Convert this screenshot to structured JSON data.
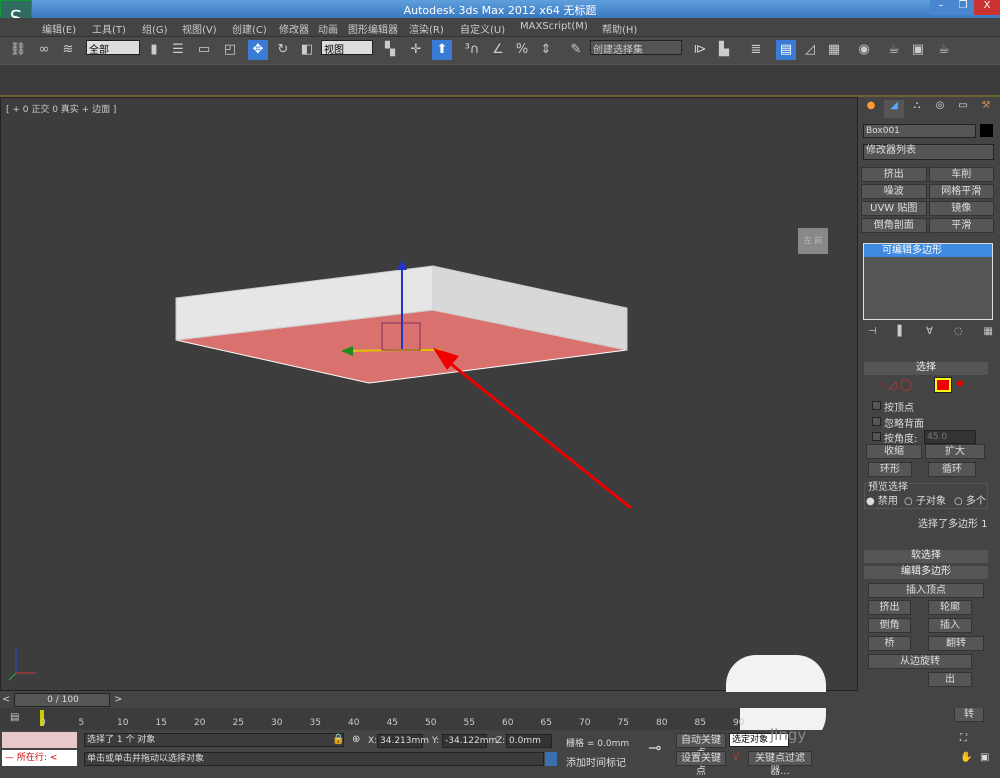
{
  "window": {
    "title": "Autodesk 3ds Max  2012 x64    无标题",
    "minimize": "–",
    "restore": "❐",
    "close": "X"
  },
  "menu": [
    "编辑(E)",
    "工具(T)",
    "组(G)",
    "视图(V)",
    "创建(C)",
    "修改器",
    "动画",
    "图形编辑器",
    "渲染(R)",
    "自定义(U)",
    "MAXScript(M)",
    "帮助(H)"
  ],
  "toolbar": {
    "selection_filter": "全部",
    "ref_coord": "视图",
    "named_selection": "创建选择集"
  },
  "viewport": {
    "label": "[ + 0 正交 0 真实 + 边面 ]",
    "viewcube": "左 前",
    "axis_labels": {
      "x": "x",
      "y": "y",
      "z": "z"
    },
    "colors": {
      "floor": "#d9726e",
      "walls": "#e4e4e4",
      "arrow": "#e00000"
    }
  },
  "panel": {
    "tabs": [
      "create-icon",
      "modify-icon",
      "hierarchy-icon",
      "motion-icon",
      "display-icon",
      "utilities-icon"
    ],
    "object_name": "Box001",
    "modifier_list": "修改器列表",
    "modifier_buttons": [
      "挤出",
      "车削",
      "噪波",
      "网格平滑",
      "UVW 贴图",
      "镜像",
      "倒角剖面",
      "平滑"
    ],
    "stack_item": "可编辑多边形",
    "selection": {
      "title": "选择",
      "by_vertex": "按顶点",
      "ignore_backfacing": "忽略背面",
      "by_angle": "按角度:",
      "angle": "45.0",
      "shrink": "收缩",
      "grow": "扩大",
      "ring": "环形",
      "loop": "循环",
      "preview": "预览选择",
      "preview_opts": [
        "禁用",
        "子对象",
        "多个"
      ],
      "status": "选择了多边形 1"
    },
    "soft_selection": "软选择",
    "edit_polygons": {
      "title": "编辑多边形",
      "insert_vertex": "插入顶点",
      "extrude": "挤出",
      "outline": "轮廓",
      "bevel": "倒角",
      "inset": "插入",
      "bridge": "桥",
      "flip": "翻转",
      "hinge": "从边旋转",
      "extrude_spline": "出",
      "turn": "转"
    }
  },
  "timeline": {
    "frame": "0 / 100",
    "ticks": [
      "0",
      "5",
      "10",
      "15",
      "20",
      "25",
      "30",
      "35",
      "40",
      "45",
      "50",
      "55",
      "60",
      "65",
      "70",
      "75",
      "80",
      "85",
      "90"
    ]
  },
  "status": {
    "script_label": "所在行:",
    "selected": "选择了 1 个 对象",
    "prompt": "单击或单击并拖动以选择对象",
    "x_label": "X:",
    "x": "34.213mm",
    "y_label": "Y:",
    "y": "-34.122mm",
    "z_label": "Z:",
    "z": "0.0mm",
    "grid": "栅格 = 0.0mm",
    "add_time_tag": "添加时间标记",
    "auto_key": "自动关键点",
    "set_key": "设置关键点",
    "key_mode": "选定对象",
    "key_filters": "关键点过滤器...",
    "watermark": "jingy"
  }
}
